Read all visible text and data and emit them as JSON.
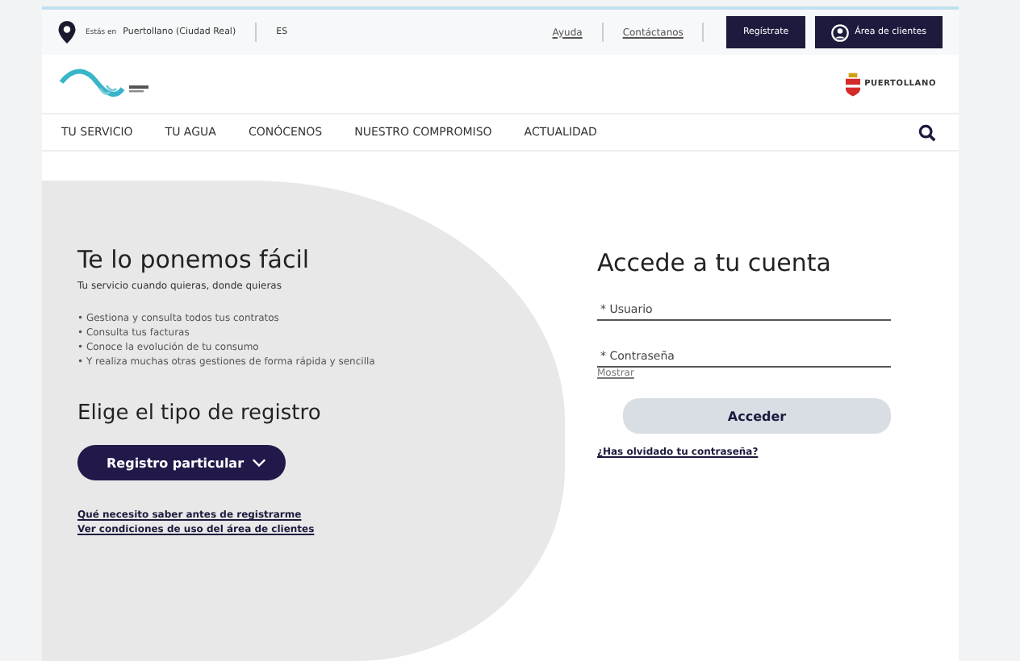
{
  "top_bar": {
    "location_prefix": "Estás en",
    "location": "Puertollano (Ciudad Real)",
    "language": "ES",
    "links": [
      "Ayuda",
      "Contáctanos"
    ],
    "register_button": "Regístrate",
    "clients_button": "Área de clientes"
  },
  "header": {
    "crest_text": "PUERTOLLANO"
  },
  "nav": {
    "items": [
      "TU SERVICIO",
      "TU AGUA",
      "CONÓCENOS",
      "NUESTRO COMPROMISO",
      "ACTUALIDAD"
    ]
  },
  "intro": {
    "title": "Te lo ponemos fácil",
    "subtitle": "Tu servicio cuando quieras, donde quieras",
    "bullets": [
      "• Gestiona y consulta todos tus contratos",
      "• Consulta tus facturas",
      "• Conoce la evolución de tu consumo",
      "• Y realiza muchas otras gestiones de forma rápida y sencilla"
    ],
    "register_title": "Elige el tipo de registro",
    "register_select": "Registro particular",
    "links": [
      "Qué necesito saber antes de registrarme",
      "Ver condiciones de uso del área de clientes"
    ]
  },
  "login": {
    "title": "Accede a tu cuenta",
    "user_placeholder": "* Usuario",
    "password_placeholder": "* Contraseña",
    "show_link": "Mostrar",
    "submit": "Acceder",
    "forgot_link": "¿Has olvidado tu contraseña?"
  }
}
